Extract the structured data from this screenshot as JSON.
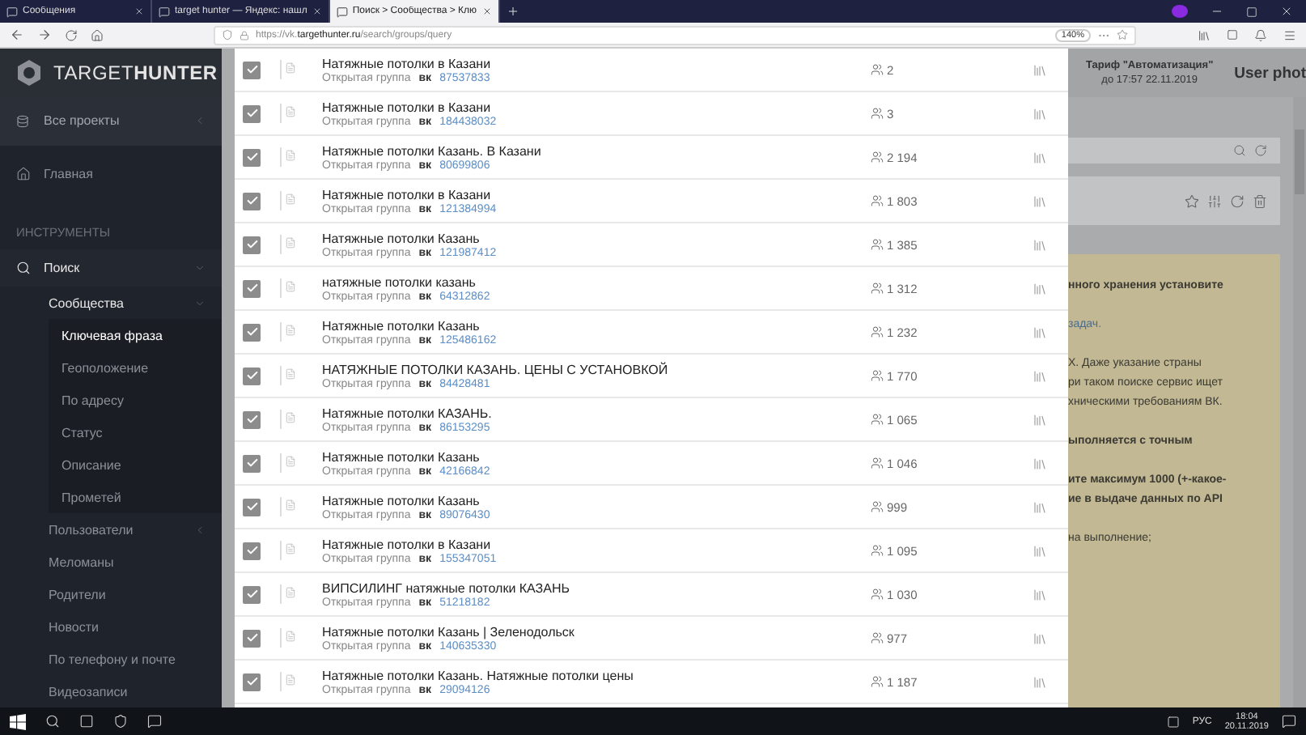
{
  "browser": {
    "tabs": [
      {
        "label": "Сообщения",
        "selected": false
      },
      {
        "label": "target hunter — Яндекс: нашл",
        "selected": false
      },
      {
        "label": "Поиск > Сообщества > Клю",
        "selected": true
      }
    ],
    "url": {
      "prefix": "https://vk.",
      "host": "targethunter.ru",
      "path": "/search/groups/query"
    },
    "zoom": "140%"
  },
  "sidebar": {
    "logo": "TARGET**HUNTER**",
    "projects": "Все проекты",
    "home": "Главная",
    "section": "ИНСТРУМЕНТЫ",
    "items": [
      {
        "label": "Поиск",
        "expanded": true,
        "selected": false,
        "children": [
          {
            "label": "Сообщества",
            "expanded": true,
            "selected": false,
            "children": [
              {
                "label": "Ключевая фраза",
                "selected": true
              },
              {
                "label": "Геоположение",
                "selected": false
              },
              {
                "label": "По адресу",
                "selected": false
              },
              {
                "label": "Статус",
                "selected": false
              },
              {
                "label": "Описание",
                "selected": false
              },
              {
                "label": "Прометей",
                "selected": false
              }
            ]
          },
          {
            "label": "Пользователи",
            "expanded": false,
            "selected": false
          },
          {
            "label": "Меломаны",
            "selected": false
          },
          {
            "label": "Родители",
            "selected": false
          },
          {
            "label": "Новости",
            "selected": false
          },
          {
            "label": "По телефону и почте",
            "selected": false
          },
          {
            "label": "Видеозаписи",
            "selected": false
          }
        ]
      }
    ]
  },
  "results": {
    "rows": [
      {
        "title": "Натяжные потолки в Казани",
        "type": "Открытая группа",
        "vk": "вк",
        "id": "87537833",
        "members": "2",
        "checked": true
      },
      {
        "title": "Натяжные потолки в Казани",
        "type": "Открытая группа",
        "vk": "вк",
        "id": "184438032",
        "members": "3",
        "checked": true
      },
      {
        "title": "Натяжные потолки Казань. В Казани",
        "type": "Открытая группа",
        "vk": "вк",
        "id": "80699806",
        "members": "2 194",
        "checked": true
      },
      {
        "title": "Натяжные потолки в Казани",
        "type": "Открытая группа",
        "vk": "вк",
        "id": "121384994",
        "members": "1 803",
        "checked": true
      },
      {
        "title": "Натяжные потолки Казань",
        "type": "Открытая группа",
        "vk": "вк",
        "id": "121987412",
        "members": "1 385",
        "checked": true
      },
      {
        "title": "натяжные потолки казань",
        "type": "Открытая группа",
        "vk": "вк",
        "id": "64312862",
        "members": "1 312",
        "checked": true
      },
      {
        "title": "Натяжные потолки Казань",
        "type": "Открытая группа",
        "vk": "вк",
        "id": "125486162",
        "members": "1 232",
        "checked": true
      },
      {
        "title": "НАТЯЖНЫЕ ПОТОЛКИ КАЗАНЬ. ЦЕНЫ С УСТАНОВКОЙ",
        "type": "Открытая группа",
        "vk": "вк",
        "id": "84428481",
        "members": "1 770",
        "checked": true
      },
      {
        "title": "Натяжные потолки КАЗАНЬ.",
        "type": "Открытая группа",
        "vk": "вк",
        "id": "86153295",
        "members": "1 065",
        "checked": true
      },
      {
        "title": "Натяжные потолки Казань",
        "type": "Открытая группа",
        "vk": "вк",
        "id": "42166842",
        "members": "1 046",
        "checked": true
      },
      {
        "title": "Натяжные потолки Казань",
        "type": "Открытая группа",
        "vk": "вк",
        "id": "89076430",
        "members": "999",
        "checked": true
      },
      {
        "title": "Натяжные потолки в Казани",
        "type": "Открытая группа",
        "vk": "вк",
        "id": "155347051",
        "members": "1 095",
        "checked": true
      },
      {
        "title": "ВИПСИЛИНГ натяжные потолки КАЗАНЬ",
        "type": "Открытая группа",
        "vk": "вк",
        "id": "51218182",
        "members": "1 030",
        "checked": true
      },
      {
        "title": "Натяжные потолки Казань | Зеленодольск",
        "type": "Открытая группа",
        "vk": "вк",
        "id": "140635330",
        "members": "977",
        "checked": true
      },
      {
        "title": "Натяжные потолки Казань. Натяжные потолки цены",
        "type": "Открытая группа",
        "vk": "вк",
        "id": "29094126",
        "members": "1 187",
        "checked": true
      }
    ]
  },
  "header": {
    "tariff": "Тариф \"Автоматизация\"",
    "tariff_until": "до 17:57 22.11.2019",
    "user": "User phot"
  },
  "notice": [
    {
      "kind": "bold",
      "lines": [
        "нного хранения установите"
      ]
    },
    {
      "kind": "link",
      "lines": [
        "задач."
      ]
    },
    {
      "kind": "plain",
      "lines": [
        "Х. Даже указание страны",
        "ри таком поиске сервис ищет",
        "хническими требованиям ВК."
      ]
    },
    {
      "kind": "bold",
      "lines": [
        "ыполняется с точным"
      ]
    },
    {
      "kind": "bold",
      "lines": [
        "ите максимум 1000 (+-какое-",
        "ие в выдаче данных по API"
      ]
    },
    {
      "kind": "plain",
      "lines": [
        "на выполнение;"
      ]
    }
  ],
  "taskbar": {
    "language": "РУС",
    "time": "18:04",
    "date": "20.11.2019"
  }
}
